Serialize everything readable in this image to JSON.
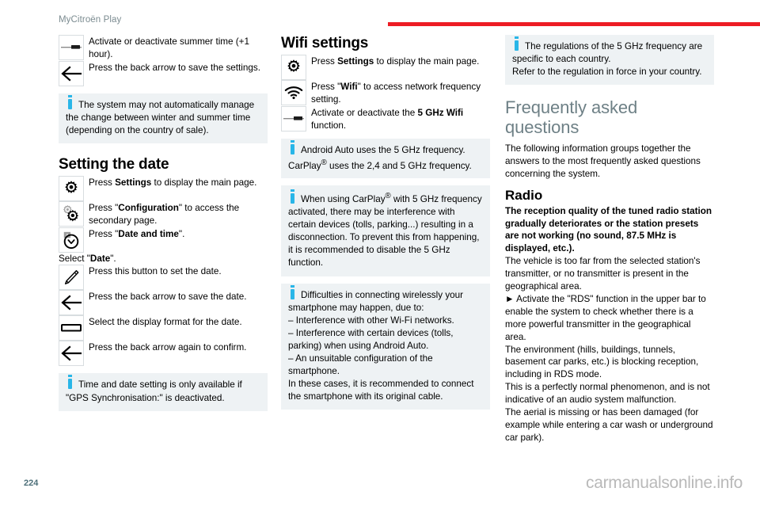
{
  "header": {
    "title": "MyCitroën Play",
    "rule_color": "#ed1c24"
  },
  "footer": {
    "page_number": "224",
    "watermark": "carmanualsonline.info"
  },
  "colors": {
    "accent_red": "#ed1c24",
    "info_blue": "#29b6e8",
    "info_bg": "#eef2f4",
    "heading_gray": "#6e8086",
    "page_number": "#4d6f79"
  },
  "column_left": {
    "summer_time_rows": [
      {
        "icon": "toggle-switch-icon",
        "text": "Activate or deactivate summer time (+1 hour)."
      },
      {
        "icon": "back-arrow-icon",
        "text": "Press the back arrow to save the settings."
      }
    ],
    "info_summer_time": {
      "lead": "The system may not automatically manage the change between winter and",
      "rest": "summer time (depending on the country of sale)."
    },
    "setting_the_date": {
      "heading": "Setting the date",
      "rows": [
        {
          "icon": "settings-gear-icon",
          "text_pre": "Press ",
          "text_bold": "Settings",
          "text_post": " to display the main page."
        },
        {
          "icon": "configuration-gears-icon",
          "text_pre": "Press \"",
          "text_bold": "Configuration",
          "text_post": "\" to access the secondary page."
        },
        {
          "icon": "date-and-time-clock-icon",
          "text_pre": "Press \"",
          "text_bold": "Date and time",
          "text_post": "\"."
        }
      ],
      "select_line_pre": "Select \"",
      "select_line_bold": "Date",
      "select_line_post": "\".",
      "rows2": [
        {
          "icon": "pencil-edit-icon",
          "text": "Press this button to set the date."
        },
        {
          "icon": "back-arrow-icon",
          "text": "Press the back arrow to save the date."
        },
        {
          "icon": "display-format-bar-icon",
          "text": "Select the display format for the date."
        },
        {
          "icon": "back-arrow-icon",
          "text": "Press the back arrow again to confirm."
        }
      ],
      "info_gps": {
        "lead": "Time and date setting is only available if \"GPS Synchronisation:\" is deactivated.",
        "rest": ""
      }
    }
  },
  "column_middle": {
    "wifi_settings": {
      "heading": "Wifi settings",
      "rows": [
        {
          "icon": "settings-gear-icon",
          "text_pre": "Press ",
          "text_bold": "Settings",
          "text_post": " to display the main page."
        },
        {
          "icon": "wifi-signal-icon",
          "text_pre": "Press \"",
          "text_bold": "Wifi",
          "text_post": "\" to access network frequency setting."
        },
        {
          "icon": "toggle-switch-icon",
          "text_pre": "Activate or deactivate the ",
          "text_bold": "5 GHz Wifi",
          "text_post": " function."
        }
      ]
    },
    "info_frequencies": {
      "lead": "Android Auto uses the 5 GHz frequency. CarPlay",
      "sup": "®",
      "lead2": " uses the 2,4 and 5 GHz",
      "rest": "frequency."
    },
    "info_carplay": {
      "lead": "When using CarPlay",
      "sup": "®",
      "lead2": " with 5 GHz frequency activated, there may be",
      "rest": "interference with certain devices (tolls, parking...) resulting in a disconnection. To prevent this from happening, it is recommended to disable the 5 GHz function."
    },
    "info_difficulties": {
      "lead": "Difficulties in connecting wirelessly your smartphone may happen, due to:",
      "bullets": [
        "–  Interference with other Wi-Fi networks.",
        "–  Interference with certain devices (tolls, parking) when using Android Auto.",
        "–  An unsuitable configuration of the smartphone."
      ],
      "closing": "In these cases, it is recommended to connect the smartphone with its original cable."
    }
  },
  "column_right": {
    "info_regulations": {
      "lead": "The regulations of the 5 GHz frequency are specific to each country.",
      "rest": "Refer to the regulation in force in your country."
    },
    "faq": {
      "heading": "Frequently asked questions",
      "intro": "The following information groups together the answers to the most frequently asked questions concerning the system."
    },
    "radio": {
      "heading": "Radio",
      "bold_question": "The reception quality of the tuned radio station gradually deteriorates or the station presets are not working (no sound, 87.5 MHz is displayed, etc.).",
      "paragraphs": [
        "The vehicle is too far from the selected station's transmitter, or no transmitter is present in the geographical area.",
        "►  Activate the \"RDS\" function in the upper bar to enable the system to check whether there is a more powerful transmitter in the geographical area.",
        "The environment (hills, buildings, tunnels, basement car parks, etc.) is blocking reception, including in RDS mode.",
        "This is a perfectly normal phenomenon, and is not indicative of an audio system malfunction.",
        "The aerial is missing or has been damaged (for example while entering a car wash or underground car park)."
      ]
    }
  }
}
